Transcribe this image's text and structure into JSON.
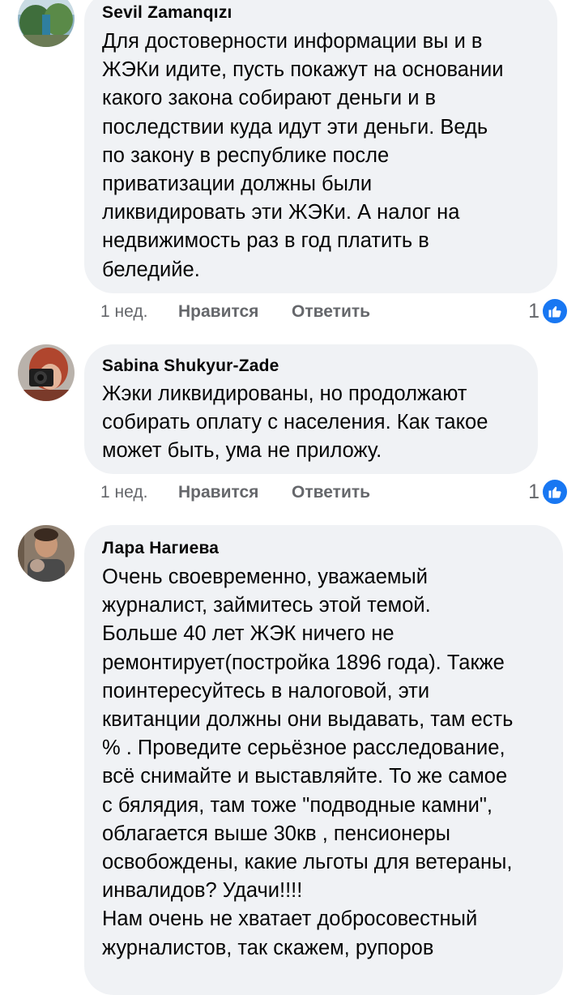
{
  "comments": [
    {
      "author": "Sevil  Zamanqızı",
      "text": "Для достоверности информации вы и в\nЖЭКи идите, пусть покажут на основании\nкакого закона собирают деньги и в\nпоследствии куда идут эти деньги. Ведь\nпо закону в республике после\nприватизации должны были\nликвидировать эти ЖЭКи. А налог на\nнедвижимость раз в год платить в\nбеледийе.",
      "time": "1 нед.",
      "like_label": "Нравится",
      "reply_label": "Ответить",
      "reaction_count": "1",
      "reaction_icon": "like-icon"
    },
    {
      "author": "Sabina Shukyur-Zade",
      "text": "Жэки ликвидированы, но продолжают\nсобирать оплату с населения. Как такое\nможет быть, ума не приложу.",
      "time": "1 нед.",
      "like_label": "Нравится",
      "reply_label": "Ответить",
      "reaction_count": "1",
      "reaction_icon": "like-icon"
    },
    {
      "author": "Лара Нагиева",
      "text": "Очень своевременно,  уважаемый\nжурналист, займитесь этой темой.\nБольше 40 лет ЖЭК ничего не\nремонтирует(постройка 1896 года). Также\nпоинтересуйтесь в налоговой, эти\nквитанции должны они выдавать, там есть\n% . Проведите серьёзное расследование,\nвсё снимайте и выставляйте. То же самое\nс бялядия, там тоже \"подводные камни\",\nоблагается выше 30кв , пенсионеры\nосвобождены, какие льготы для ветераны,\nинвалидов? Удачи!!!!\nНам очень не хватает добросовестный\nжурналистов, так скажем, рупоров"
    }
  ],
  "colors": {
    "bubble_bg": "#f0f2f5",
    "secondary_text": "#65676b",
    "like_blue": "#1877f2"
  }
}
